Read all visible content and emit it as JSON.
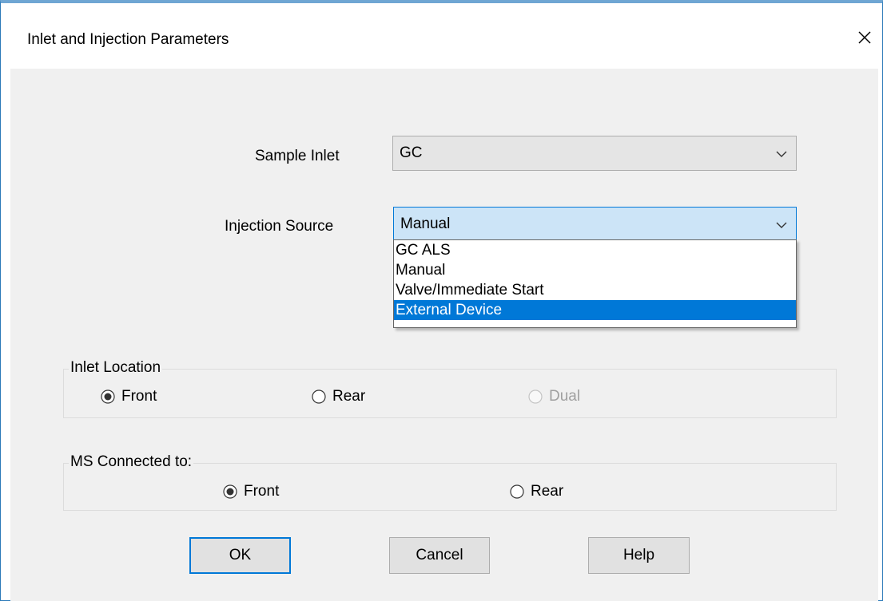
{
  "window": {
    "title": "Inlet and Injection Parameters"
  },
  "sample_inlet": {
    "label": "Sample Inlet",
    "value": "GC"
  },
  "injection_source": {
    "label": "Injection Source",
    "value": "Manual",
    "options": [
      "GC ALS",
      "Manual",
      "Valve/Immediate Start",
      "External Device"
    ],
    "highlighted_option": "External Device"
  },
  "inlet_location": {
    "legend": "Inlet Location",
    "options": [
      {
        "label": "Front",
        "checked": true,
        "enabled": true
      },
      {
        "label": "Rear",
        "checked": false,
        "enabled": true
      },
      {
        "label": "Dual",
        "checked": false,
        "enabled": false
      }
    ]
  },
  "ms_connected": {
    "legend": "MS Connected to:",
    "options": [
      {
        "label": "Front",
        "checked": true,
        "enabled": true
      },
      {
        "label": "Rear",
        "checked": false,
        "enabled": true
      }
    ]
  },
  "buttons": {
    "ok": "OK",
    "cancel": "Cancel",
    "help": "Help"
  },
  "colors": {
    "accent": "#0078d7",
    "window_border": "#2b79b8",
    "client_bg": "#f0f0f0"
  }
}
